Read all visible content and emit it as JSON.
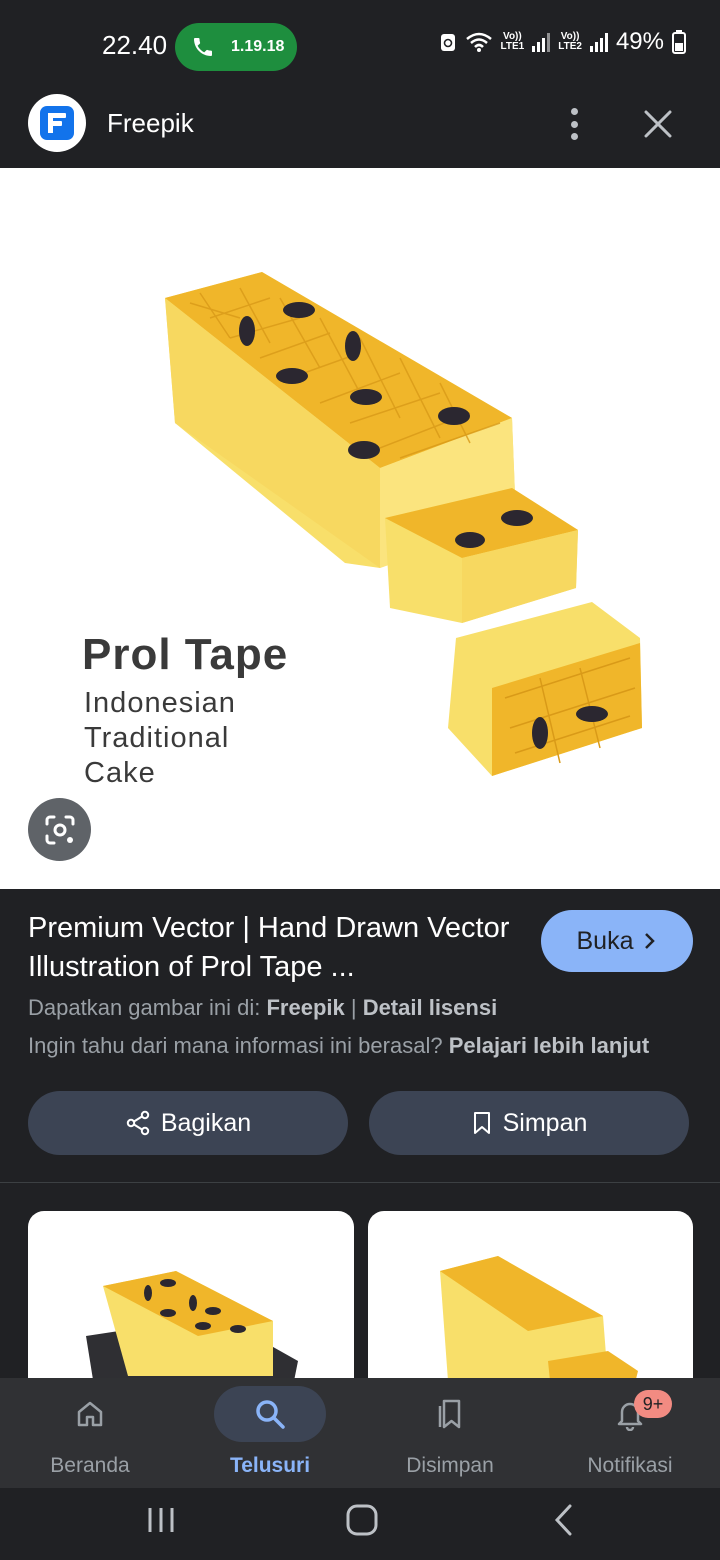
{
  "status_bar": {
    "time": "22.40",
    "call_timer": "1.19.18",
    "sim1_label": "Vo))",
    "sim1_sub": "LTE1",
    "sim2_label": "Vo))",
    "sim2_sub": "LTE2",
    "battery": "49%"
  },
  "header": {
    "site_name": "Freepik",
    "logo_icon": "freepik-logo",
    "menu_icon": "more-vert-icon",
    "close_icon": "close-icon"
  },
  "image": {
    "title": "Prol Tape",
    "subtitle_lines": [
      "Indonesian",
      "Traditional",
      "Cake"
    ],
    "lens_icon": "google-lens-icon"
  },
  "info": {
    "title": "Premium Vector | Hand Drawn Vector Illustration of Prol Tape ...",
    "open_button": "Buka",
    "source_prefix": "Dapatkan gambar ini di: ",
    "source_name": "Freepik",
    "separator": " | ",
    "license_link": "Detail lisensi",
    "learn_prefix": "Ingin tahu dari mana informasi ini berasal? ",
    "learn_link": "Pelajari lebih lanjut",
    "share_button": "Bagikan",
    "save_button": "Simpan"
  },
  "bottom_nav": {
    "items": [
      {
        "label": "Beranda",
        "icon": "home-icon"
      },
      {
        "label": "Telusuri",
        "icon": "search-icon"
      },
      {
        "label": "Disimpan",
        "icon": "saved-icon"
      },
      {
        "label": "Notifikasi",
        "icon": "bell-icon"
      }
    ],
    "active": "Telusuri",
    "notification_badge": "9+"
  },
  "colors": {
    "background": "#202124",
    "accent": "#8ab4f8",
    "call_green": "#1e8e3e",
    "badge": "#f28b82",
    "cake_yellow": "#f7d560",
    "cake_orange": "#f2b61f"
  }
}
